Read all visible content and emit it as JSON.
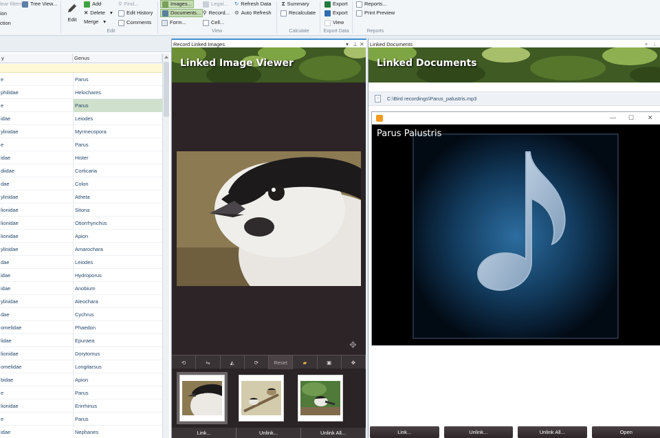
{
  "ribbon": {
    "filters_label": "lear filters",
    "tree_view_label": "Tree View...",
    "ion_label": "ion",
    "ction_label": "ction",
    "edit_label": "Edit",
    "add_label": "Add",
    "delete_label": "Delete",
    "merge_label": "Merge",
    "find_label": "Find...",
    "edit_history_label": "Edit History",
    "comments_label": "Comments",
    "edit_group": "Edit",
    "images_label": "Images...",
    "documents_label": "Documents...",
    "form_label": "Form...",
    "legal_label": "Legal...",
    "record_label": "Record...",
    "cell_label": "Cell...",
    "refresh_data_label": "Refresh Data",
    "auto_refresh_label": "Auto Refresh",
    "view_group": "View",
    "summary_label": "Summary",
    "recalculate_label": "Recalculate",
    "calculate_group": "Calculate",
    "export_label": "Export",
    "export2_label": "Export",
    "view_label": "View",
    "export_data_group": "Export Data",
    "reports_label": "Reports...",
    "print_preview_label": "Print Preview",
    "reports_group": "Reports"
  },
  "grid": {
    "col1_header": "y",
    "col2_header": "Genus",
    "rows": [
      {
        "family": "e",
        "genus": "Parus"
      },
      {
        "family": "philidae",
        "genus": "Helochares"
      },
      {
        "family": "e",
        "genus": "Parus"
      },
      {
        "family": "idae",
        "genus": "Leiodes"
      },
      {
        "family": "ylinidae",
        "genus": "Myrmecopora"
      },
      {
        "family": "e",
        "genus": "Parus"
      },
      {
        "family": "idae",
        "genus": "Hister"
      },
      {
        "family": "diidae",
        "genus": "Corticaria"
      },
      {
        "family": "dae",
        "genus": "Colon"
      },
      {
        "family": "ylinidae",
        "genus": "Atheta"
      },
      {
        "family": "lionidae",
        "genus": "Sitona"
      },
      {
        "family": "lionidae",
        "genus": "Otiorrhynchus"
      },
      {
        "family": "lionidae",
        "genus": "Apion"
      },
      {
        "family": "ylinidae",
        "genus": "Amarochara"
      },
      {
        "family": "dae",
        "genus": "Leiodes"
      },
      {
        "family": "idae",
        "genus": "Hydroporus"
      },
      {
        "family": "idae",
        "genus": "Anobium"
      },
      {
        "family": "ylinidae",
        "genus": "Aleochara"
      },
      {
        "family": "dae",
        "genus": "Cychrus"
      },
      {
        "family": "omelidae",
        "genus": "Phaedon"
      },
      {
        "family": "lidae",
        "genus": "Epuraea"
      },
      {
        "family": "lionidae",
        "genus": "Dorytomus"
      },
      {
        "family": "omelidae",
        "genus": "Longitarsus"
      },
      {
        "family": "bidae",
        "genus": "Apion"
      },
      {
        "family": "e",
        "genus": "Parus"
      },
      {
        "family": "lionidae",
        "genus": "Erirrhinus"
      },
      {
        "family": "e",
        "genus": "Parus"
      },
      {
        "family": "idae",
        "genus": "Nephanes"
      }
    ]
  },
  "image_panel": {
    "title": "Record Linked Images",
    "banner": "Linked Image Viewer",
    "reset_label": "Reset",
    "link_label": "Link...",
    "unlink_label": "Unlink...",
    "unlink_all_label": "Unlink All..."
  },
  "doc_panel": {
    "title": "Linked Documents",
    "banner": "Linked Documents",
    "file_path": "C:\\Bird recordings\\Parus_palustris.mp3",
    "track_title": "Parus Palustris",
    "link_label": "Link...",
    "unlink_label": "Unlink...",
    "unlink_all_label": "Unlink All...",
    "open_label": "Open"
  },
  "colors": {
    "accent_tab": "#3d8fd4",
    "selected_row": "#cfe0cc",
    "filter_row": "#fff8d6",
    "dark_panel": "#2b2426"
  }
}
